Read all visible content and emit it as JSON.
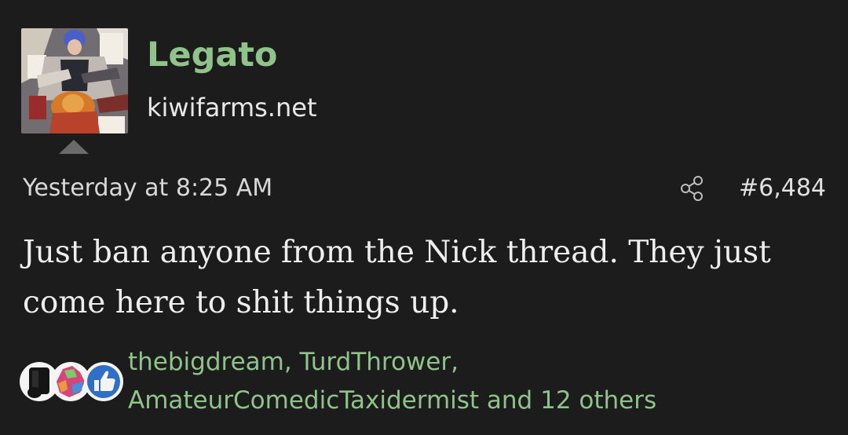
{
  "post": {
    "author": "Legato",
    "user_title": "kiwifarms.net",
    "timestamp": "Yesterday at 8:25 AM",
    "post_number": "#6,484",
    "body": "Just ban anyone from the Nick thread. They just come here to shit things up."
  },
  "reactions": {
    "line1": "thebigdream, TurdThrower,",
    "line2": "AmateurComedicTaxidermist and 12 others",
    "icons": [
      "dumb-reaction-icon",
      "map-reaction-icon",
      "thumbs-up-icon"
    ]
  },
  "colors": {
    "background": "#1c1c1c",
    "accent_green": "#8fc38a",
    "text": "#eeeeee"
  }
}
